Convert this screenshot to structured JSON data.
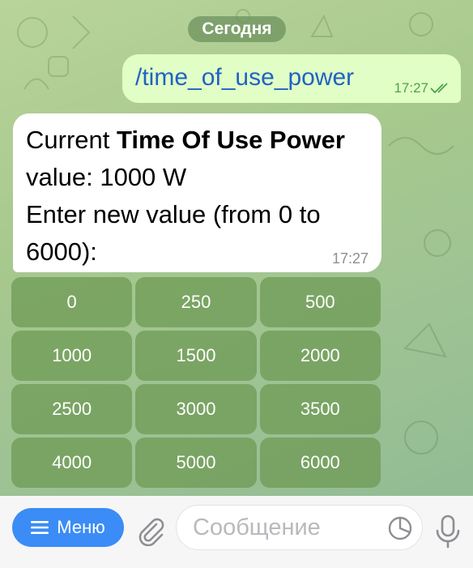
{
  "date_divider": "Сегодня",
  "outgoing": {
    "text": "/time_of_use_power",
    "time": "17:27",
    "status_icon": "double-check-icon"
  },
  "incoming": {
    "pre": "Current ",
    "bold": "Time Of Use Power",
    "line1_rest": "value: 1000 W",
    "line2": "Enter new value (from 0 to 6000):",
    "time": "17:27"
  },
  "keyboard": {
    "buttons": [
      "0",
      "250",
      "500",
      "1000",
      "1500",
      "2000",
      "2500",
      "3000",
      "3500",
      "4000",
      "5000",
      "6000"
    ]
  },
  "input_bar": {
    "menu_label": "Меню",
    "placeholder": "Сообщение",
    "icons": [
      "menu-lines-icon",
      "attach-clip-icon",
      "sticker-icon",
      "microphone-icon"
    ]
  },
  "colors": {
    "accent": "#3b8cf6",
    "outgoing_bubble": "#e1fec6",
    "command_link": "#1f63c4",
    "keyboard_button": "#6c9852"
  }
}
